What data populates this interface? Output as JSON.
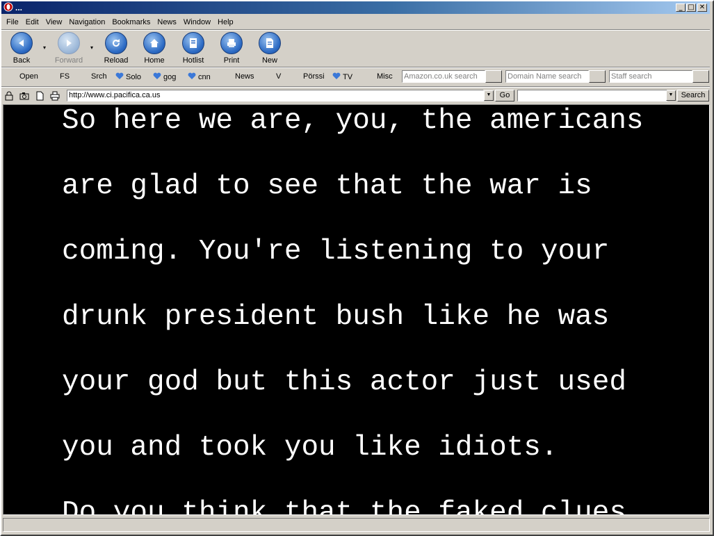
{
  "window": {
    "title": "...",
    "controls": {
      "minimize": "_",
      "maximize": "□",
      "close": "✕"
    }
  },
  "menu": [
    "File",
    "Edit",
    "View",
    "Navigation",
    "Bookmarks",
    "News",
    "Window",
    "Help"
  ],
  "toolbar": {
    "back": "Back",
    "forward": "Forward",
    "reload": "Reload",
    "home": "Home",
    "hotlist": "Hotlist",
    "print": "Print",
    "new": "New"
  },
  "links": {
    "open": "Open",
    "fs": "FS",
    "srch": "Srch",
    "solo": "Solo",
    "gog": "gog",
    "cnn": "cnn",
    "news": "News",
    "v": "V",
    "porssi": "Pörssi",
    "tv": "TV",
    "misc": "Misc"
  },
  "searches": {
    "amazon": "Amazon.co.uk search",
    "domain": "Domain Name search",
    "staff": "Staff search"
  },
  "address": {
    "url": "http://www.ci.pacifica.ca.us",
    "go": "Go",
    "search_value": "",
    "search_button": "Search"
  },
  "content": {
    "lines": [
      "So here we are, you, the americans",
      "are glad to see that the war is",
      "coming. You're listening to your",
      "drunk president bush like he was",
      "your god but this actor just used",
      "you and took you like idiots.",
      "Do you think that the faked clues"
    ]
  },
  "status": {
    "text": ""
  },
  "colors": {
    "title_gradient_start": "#0a246a",
    "content_bg": "#000000",
    "content_text": "#ffffff",
    "chrome": "#d4d0c8"
  }
}
